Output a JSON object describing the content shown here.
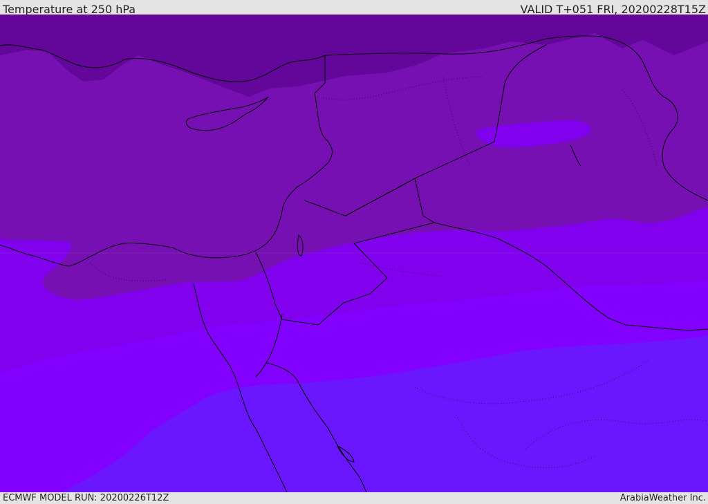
{
  "header": {
    "title": "Temperature at 250 hPa",
    "valid": "VALID T+051 FRI, 20200228T15Z"
  },
  "footer": {
    "model_run": "ECMWF MODEL RUN: 20200226T12Z",
    "credit": "ArabiaWeather Inc."
  },
  "colors": {
    "band_coldest": "#63069a",
    "band_cold": "#7710b2",
    "band_mid": "#8100ee",
    "band_warm": "#8100ff",
    "band_warmest": "#6a17ff",
    "coastline": "#000000",
    "bar_background": "#e4e4e4"
  }
}
